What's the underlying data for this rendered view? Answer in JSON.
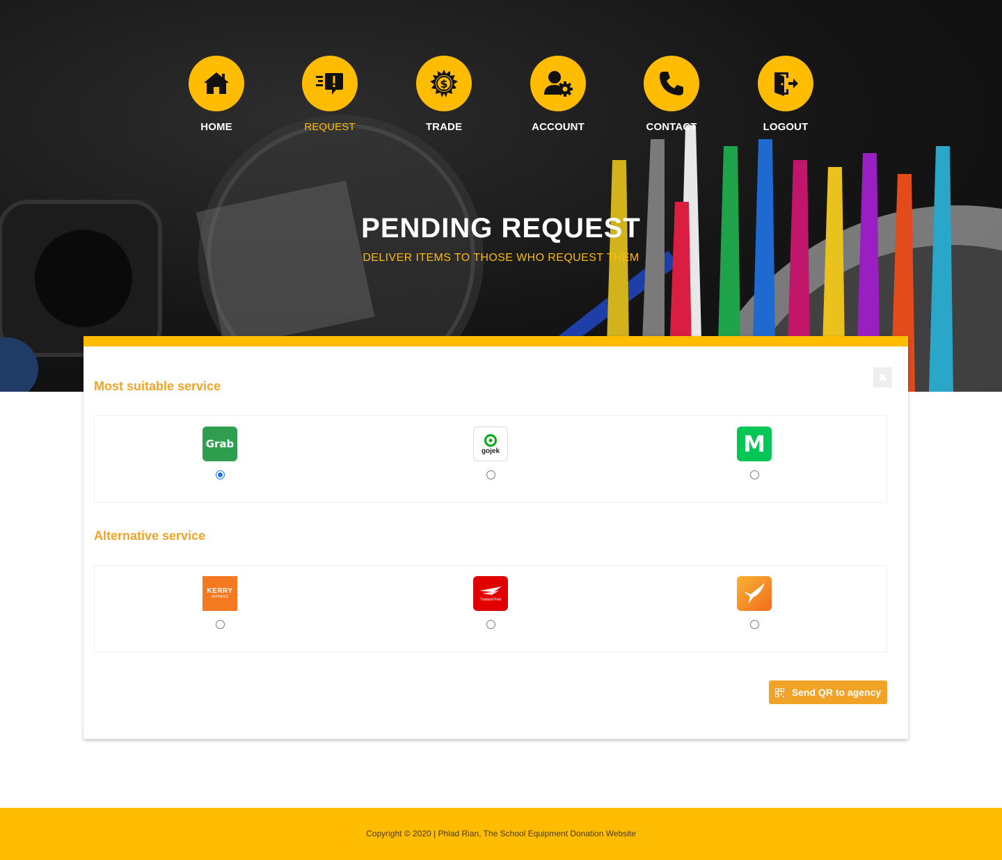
{
  "nav": {
    "items": [
      {
        "label": "HOME",
        "icon": "home-icon"
      },
      {
        "label": "REQUEST",
        "icon": "request-icon"
      },
      {
        "label": "TRADE",
        "icon": "money-gear-icon"
      },
      {
        "label": "ACCOUNT",
        "icon": "user-gear-icon"
      },
      {
        "label": "CONTACT",
        "icon": "phone-icon"
      },
      {
        "label": "LOGOUT",
        "icon": "logout-icon"
      }
    ],
    "active": "REQUEST"
  },
  "hero": {
    "title": "PENDING REQUEST",
    "subtitle": "DELIVER ITEMS TO THOSE WHO REQUEST THEM"
  },
  "card": {
    "close_icon": "close-icon",
    "most_suitable": {
      "title": "Most suitable service",
      "options": [
        {
          "logo_text": "Grab",
          "selected": true
        },
        {
          "logo_text": "gojek",
          "selected": false
        },
        {
          "logo_text": "M",
          "selected": false
        }
      ]
    },
    "alternative": {
      "title": "Alternative service",
      "options": [
        {
          "logo_text": "KERRY",
          "logo_subtext": "EXPRESS",
          "selected": false
        },
        {
          "logo_text": "Thailand Post",
          "selected": false
        },
        {
          "logo_text": "",
          "selected": false
        }
      ]
    },
    "send_button": {
      "label": "Send QR to agency",
      "icon": "qr-icon"
    }
  },
  "footer": {
    "copyright": "Copyright © 2020 | Phlad Rian, The School Equipment Donation Website"
  },
  "colors": {
    "accent": "#ffbc00",
    "heading": "#f0a326",
    "grab": "#2f9e4f",
    "gojek": "#00aa13",
    "lineman": "#06c755",
    "kerry": "#f47920",
    "thaipost": "#e10000",
    "flash": "#f7941d"
  }
}
